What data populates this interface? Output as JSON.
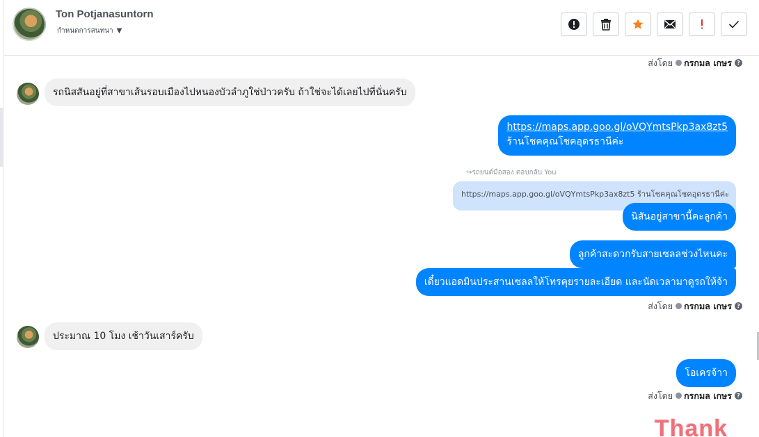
{
  "header": {
    "contact_name": "Ton Potjanasuntorn",
    "conversation_label": "กำหนดการสนทนา",
    "toolbar": [
      {
        "name": "spam-button",
        "icon": "exclamation-circle-icon",
        "glyph": "!"
      },
      {
        "name": "delete-button",
        "icon": "trash-icon",
        "glyph": ""
      },
      {
        "name": "star-button",
        "icon": "star-icon",
        "glyph": "★"
      },
      {
        "name": "mark-unread-button",
        "icon": "envelope-icon",
        "glyph": ""
      },
      {
        "name": "follow-up-button",
        "icon": "exclamation-icon",
        "glyph": "!"
      },
      {
        "name": "mark-done-button",
        "icon": "check-icon",
        "glyph": "✓"
      }
    ]
  },
  "sent_by": {
    "label": "ส่งโดย",
    "sender": "กรกมล เกษร",
    "help": "?"
  },
  "messages": {
    "m1": "รถนิสสันอยู่ที่สาขาเส้นรอบเมืองไปหนองบัวลำภูใช่ป่าวครับ ถ้าใช่จะได้เลยไปที่นั่นครับ",
    "m2_link": "https://maps.app.goo.gl/oVQYmtsPkp3ax8zt5",
    "m2_text": "ร้านโชคคุณโชคอุดรธานีค่ะ",
    "reply_meta": "↪รถยนต์มือสอง ตอบกลับ You",
    "quoted": "https://maps.app.goo.gl/oVQYmtsPkp3ax8zt5 ร้านโชคคุณโชคอุดรธานีค่ะ",
    "m3": "นิสันอยู่สาขานี้คะลูกค้า",
    "m4": "ลูกค้าสะดวกรับสายเซลลช่วงไหนคะ",
    "m5": "เดี๋ยวแอดมินประสานเซลลให้โทรคุยรายละเอียด และนัดเวลามาดูรถให้จ้า",
    "m6": "ประมาณ 10 โมง เช้าวันเสาร์ครับ",
    "m7": "โอเครจ้าา",
    "sticker": "Thank"
  },
  "colors": {
    "outgoing_bubble": "#0084ff",
    "incoming_bubble": "#f1f0f0",
    "quoted_bubble": "#cfe3fc",
    "star": "#f5821f",
    "alert": "#e02c2c"
  }
}
